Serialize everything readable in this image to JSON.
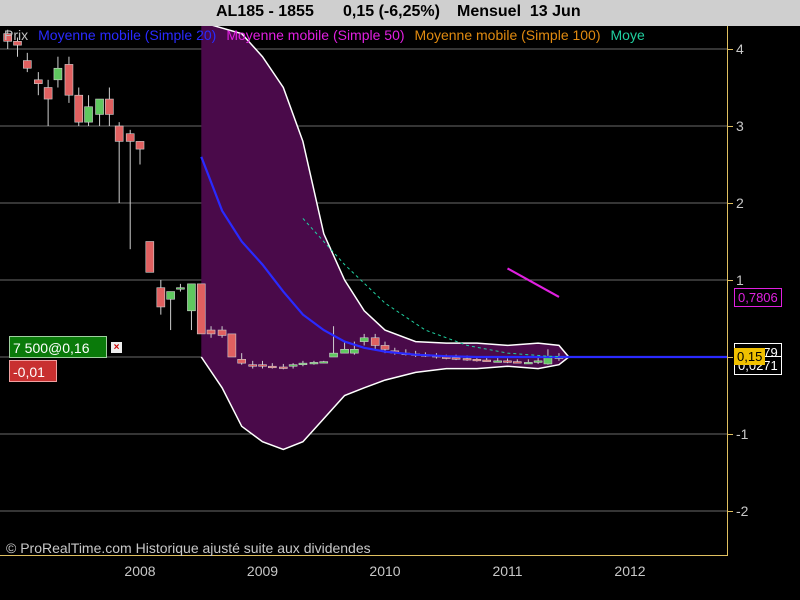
{
  "header": {
    "symbol": "AL185 - 1855",
    "change": "0,15 (-6,25%)",
    "period": "Mensuel  13 Jun"
  },
  "legend": [
    {
      "label": "Prix",
      "color": "#c0c0c0"
    },
    {
      "label": "Moyenne mobile (Simple 20)",
      "color": "#2a2aff"
    },
    {
      "label": "Moyenne mobile (Simple 50)",
      "color": "#e020e0"
    },
    {
      "label": "Moyenne mobile (Simple 100)",
      "color": "#e08a10"
    },
    {
      "label": "Moye",
      "color": "#20d0a0"
    }
  ],
  "order": {
    "label": "7 500@0,16",
    "close": "×",
    "pnl": "-0,01"
  },
  "badges": {
    "ma_value": "0,7806",
    "last_price": "0,15",
    "upper_band": "0,2479",
    "lower_band": "0,0271"
  },
  "copyright": "© ProRealTime.com Historique ajusté suite aux dividendes",
  "colors": {
    "background": "#000000",
    "up_candle": "#5fc85f",
    "down_candle": "#e06060",
    "band_fill": "#4a0a4a",
    "band_edge": "#ffffff",
    "sma20": "#2a2aff",
    "sma50": "#e020e0",
    "axis_border": "#e0c060"
  },
  "chart_data": {
    "type": "candlestick",
    "title": "AL185 - 1855",
    "ylim": [
      -2.1,
      4.35
    ],
    "y_ticks": [
      "4",
      "3",
      "2",
      "1",
      "0",
      "-1",
      "-2"
    ],
    "y_tick_values": [
      4,
      3,
      2,
      1,
      0,
      -1,
      -2
    ],
    "x_ticks": [
      "2008",
      "2009",
      "2010",
      "2011",
      "2012"
    ],
    "x_tick_values": [
      2008.0,
      2009.0,
      2010.0,
      2011.0,
      2012.0
    ],
    "xlim": [
      2006.85,
      2012.85
    ],
    "candles": [
      {
        "t": 2006.92,
        "o": 4.2,
        "h": 4.25,
        "l": 4.0,
        "c": 4.1
      },
      {
        "t": 2007.0,
        "o": 4.1,
        "h": 4.15,
        "l": 3.9,
        "c": 4.05
      },
      {
        "t": 2007.08,
        "o": 3.85,
        "h": 3.95,
        "l": 3.7,
        "c": 3.75
      },
      {
        "t": 2007.17,
        "o": 3.6,
        "h": 3.7,
        "l": 3.4,
        "c": 3.55
      },
      {
        "t": 2007.25,
        "o": 3.5,
        "h": 3.6,
        "l": 3.0,
        "c": 3.35
      },
      {
        "t": 2007.33,
        "o": 3.6,
        "h": 3.9,
        "l": 3.5,
        "c": 3.75
      },
      {
        "t": 2007.42,
        "o": 3.8,
        "h": 3.9,
        "l": 3.3,
        "c": 3.4
      },
      {
        "t": 2007.5,
        "o": 3.4,
        "h": 3.5,
        "l": 3.0,
        "c": 3.05
      },
      {
        "t": 2007.58,
        "o": 3.05,
        "h": 3.4,
        "l": 3.0,
        "c": 3.25
      },
      {
        "t": 2007.67,
        "o": 3.15,
        "h": 3.3,
        "l": 3.0,
        "c": 3.35
      },
      {
        "t": 2007.75,
        "o": 3.35,
        "h": 3.5,
        "l": 3.0,
        "c": 3.15
      },
      {
        "t": 2007.83,
        "o": 3.0,
        "h": 3.05,
        "l": 2.0,
        "c": 2.8
      },
      {
        "t": 2007.92,
        "o": 2.9,
        "h": 2.95,
        "l": 1.4,
        "c": 2.8
      },
      {
        "t": 2008.0,
        "o": 2.8,
        "h": 2.8,
        "l": 2.5,
        "c": 2.7
      },
      {
        "t": 2008.08,
        "o": 1.5,
        "h": 1.5,
        "l": 1.1,
        "c": 1.1
      },
      {
        "t": 2008.17,
        "o": 0.9,
        "h": 1.0,
        "l": 0.55,
        "c": 0.65
      },
      {
        "t": 2008.25,
        "o": 0.75,
        "h": 0.85,
        "l": 0.35,
        "c": 0.85
      },
      {
        "t": 2008.33,
        "o": 0.9,
        "h": 0.95,
        "l": 0.85,
        "c": 0.9
      },
      {
        "t": 2008.42,
        "o": 0.6,
        "h": 0.95,
        "l": 0.35,
        "c": 0.95
      },
      {
        "t": 2008.5,
        "o": 0.95,
        "h": 0.95,
        "l": 0.3,
        "c": 0.3
      },
      {
        "t": 2008.58,
        "o": 0.35,
        "h": 0.4,
        "l": 0.25,
        "c": 0.3
      },
      {
        "t": 2008.67,
        "o": 0.35,
        "h": 0.4,
        "l": 0.25,
        "c": 0.28
      },
      {
        "t": 2008.75,
        "o": 0.3,
        "h": 0.3,
        "l": 0.0,
        "c": 0.0
      },
      {
        "t": 2008.83,
        "o": -0.03,
        "h": 0.05,
        "l": -0.1,
        "c": -0.08
      },
      {
        "t": 2008.92,
        "o": -0.1,
        "h": -0.05,
        "l": -0.15,
        "c": -0.12
      },
      {
        "t": 2009.0,
        "o": -0.1,
        "h": -0.05,
        "l": -0.15,
        "c": -0.12
      },
      {
        "t": 2009.08,
        "o": -0.12,
        "h": -0.08,
        "l": -0.15,
        "c": -0.13
      },
      {
        "t": 2009.17,
        "o": -0.13,
        "h": -0.09,
        "l": -0.16,
        "c": -0.14
      },
      {
        "t": 2009.25,
        "o": -0.12,
        "h": -0.08,
        "l": -0.15,
        "c": -0.1
      },
      {
        "t": 2009.33,
        "o": -0.1,
        "h": -0.05,
        "l": -0.12,
        "c": -0.08
      },
      {
        "t": 2009.42,
        "o": -0.08,
        "h": -0.05,
        "l": -0.1,
        "c": -0.07
      },
      {
        "t": 2009.5,
        "o": -0.07,
        "h": -0.05,
        "l": -0.08,
        "c": -0.06
      },
      {
        "t": 2009.58,
        "o": 0.0,
        "h": 0.4,
        "l": 0.0,
        "c": 0.05
      },
      {
        "t": 2009.67,
        "o": 0.05,
        "h": 0.2,
        "l": 0.05,
        "c": 0.1
      },
      {
        "t": 2009.75,
        "o": 0.05,
        "h": 0.2,
        "l": 0.03,
        "c": 0.1
      },
      {
        "t": 2009.83,
        "o": 0.2,
        "h": 0.3,
        "l": 0.15,
        "c": 0.25
      },
      {
        "t": 2009.92,
        "o": 0.25,
        "h": 0.3,
        "l": 0.1,
        "c": 0.15
      },
      {
        "t": 2010.0,
        "o": 0.15,
        "h": 0.2,
        "l": 0.05,
        "c": 0.1
      },
      {
        "t": 2010.08,
        "o": 0.08,
        "h": 0.12,
        "l": 0.03,
        "c": 0.05
      },
      {
        "t": 2010.17,
        "o": 0.05,
        "h": 0.1,
        "l": 0.02,
        "c": 0.04
      },
      {
        "t": 2010.25,
        "o": 0.04,
        "h": 0.08,
        "l": 0.0,
        "c": 0.03
      },
      {
        "t": 2010.33,
        "o": 0.03,
        "h": 0.06,
        "l": 0.0,
        "c": 0.02
      },
      {
        "t": 2010.42,
        "o": 0.02,
        "h": 0.05,
        "l": -0.02,
        "c": 0.0
      },
      {
        "t": 2010.5,
        "o": 0.0,
        "h": 0.03,
        "l": -0.03,
        "c": -0.01
      },
      {
        "t": 2010.58,
        "o": -0.01,
        "h": 0.03,
        "l": -0.04,
        "c": -0.02
      },
      {
        "t": 2010.67,
        "o": -0.02,
        "h": 0.02,
        "l": -0.05,
        "c": -0.03
      },
      {
        "t": 2010.75,
        "o": -0.03,
        "h": 0.0,
        "l": -0.06,
        "c": -0.04
      },
      {
        "t": 2010.83,
        "o": -0.04,
        "h": 0.0,
        "l": -0.06,
        "c": -0.05
      },
      {
        "t": 2010.92,
        "o": -0.05,
        "h": -0.01,
        "l": -0.07,
        "c": -0.05
      },
      {
        "t": 2011.0,
        "o": -0.05,
        "h": -0.02,
        "l": -0.08,
        "c": -0.06
      },
      {
        "t": 2011.08,
        "o": -0.06,
        "h": -0.03,
        "l": -0.08,
        "c": -0.07
      },
      {
        "t": 2011.17,
        "o": -0.07,
        "h": -0.03,
        "l": -0.09,
        "c": -0.07
      },
      {
        "t": 2011.25,
        "o": -0.07,
        "h": 0.0,
        "l": -0.09,
        "c": -0.05
      },
      {
        "t": 2011.33,
        "o": -0.09,
        "h": 0.1,
        "l": -0.1,
        "c": 0.0
      },
      {
        "t": 2011.42,
        "o": 0.0,
        "h": 0.05,
        "l": -0.05,
        "c": 0.0
      }
    ],
    "series": [
      {
        "name": "Moyenne mobile (Simple 20)",
        "color": "#2a2aff",
        "x": [
          2008.5,
          2008.67,
          2008.83,
          2009.0,
          2009.17,
          2009.33,
          2009.5,
          2009.67,
          2009.83,
          2010.0,
          2010.25,
          2010.5,
          2010.75,
          2011.0,
          2011.25,
          2011.5,
          2012.8
        ],
        "y": [
          2.6,
          1.9,
          1.5,
          1.2,
          0.85,
          0.55,
          0.35,
          0.2,
          0.12,
          0.07,
          0.03,
          0.01,
          0.0,
          0.0,
          0.0,
          0.0,
          0.0
        ]
      },
      {
        "name": "Moyenne mobile (Simple 50)",
        "color": "#e020e0",
        "x": [
          2011.0,
          2011.42
        ],
        "y": [
          1.15,
          0.78
        ]
      },
      {
        "name": "Moye",
        "color": "#20d0a0",
        "dashed": true,
        "x": [
          2009.33,
          2009.67,
          2010.0,
          2010.33,
          2010.67,
          2011.0,
          2011.33,
          2011.5
        ],
        "y": [
          1.8,
          1.2,
          0.7,
          0.35,
          0.15,
          0.05,
          0.01,
          0.0
        ]
      }
    ],
    "band_upper": {
      "x": [
        2008.5,
        2008.83,
        2009.0,
        2009.17,
        2009.33,
        2009.5,
        2009.67,
        2009.83,
        2010.0,
        2010.25,
        2010.5,
        2010.75,
        2011.0,
        2011.25,
        2011.42,
        2011.5
      ],
      "y": [
        4.35,
        4.2,
        3.9,
        3.5,
        2.8,
        1.6,
        1.0,
        0.6,
        0.35,
        0.2,
        0.18,
        0.18,
        0.15,
        0.18,
        0.15,
        0.0
      ]
    },
    "band_lower": {
      "x": [
        2008.5,
        2008.67,
        2008.83,
        2009.0,
        2009.17,
        2009.33,
        2009.5,
        2009.67,
        2009.83,
        2010.0,
        2010.25,
        2010.5,
        2010.75,
        2011.0,
        2011.25,
        2011.42,
        2011.5
      ],
      "y": [
        0.0,
        -0.4,
        -0.9,
        -1.1,
        -1.2,
        -1.1,
        -0.8,
        -0.5,
        -0.4,
        -0.3,
        -0.2,
        -0.15,
        -0.15,
        -0.12,
        -0.15,
        -0.1,
        0.0
      ]
    }
  }
}
